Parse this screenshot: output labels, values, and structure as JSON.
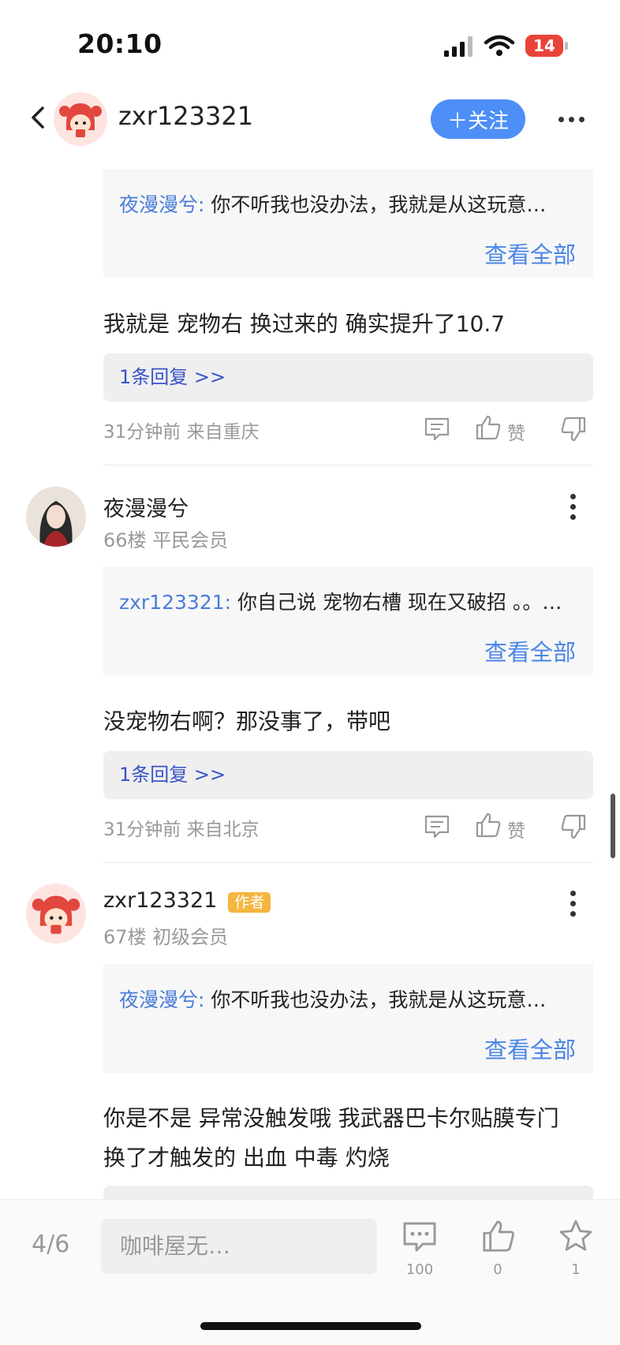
{
  "status_bar": {
    "time": "20:10",
    "battery": "14"
  },
  "header": {
    "username": "zxr123321",
    "follow_label": "＋关注"
  },
  "comment_top": {
    "quote_user": "夜漫漫兮:",
    "quote_text": " 你不听我也没办法，我就是从这玩意…",
    "view_all": "查看全部",
    "text": "我就是 宠物右 换过来的 确实提升了10.7",
    "replies": "1条回复 >>",
    "meta": "31分钟前 来自重庆",
    "like_label": "赞"
  },
  "comment_66": {
    "username": "夜漫漫兮",
    "floor": "66楼 平民会员",
    "quote_user": "zxr123321:",
    "quote_text": " 你自己说 宠物右槽 现在又破招 。。…",
    "view_all": "查看全部",
    "text": "没宠物右啊？那没事了，带吧",
    "replies": "1条回复 >>",
    "meta": "31分钟前 来自北京",
    "like_label": "赞"
  },
  "comment_67": {
    "username": "zxr123321",
    "badge": "作者",
    "floor": "67楼 初级会员",
    "quote_user": "夜漫漫兮:",
    "quote_text": " 你不听我也没办法，我就是从这玩意…",
    "view_all": "查看全部",
    "text_line1": "你是不是 异常没触发哦 我武器巴卡尔贴膜专门",
    "text_line2": "换了才触发的 出血 中毒 灼烧"
  },
  "bottom_bar": {
    "page": "4/6",
    "input_placeholder": "咖啡屋无…",
    "comment_count": "100",
    "like_count": "0",
    "star_count": "1"
  }
}
